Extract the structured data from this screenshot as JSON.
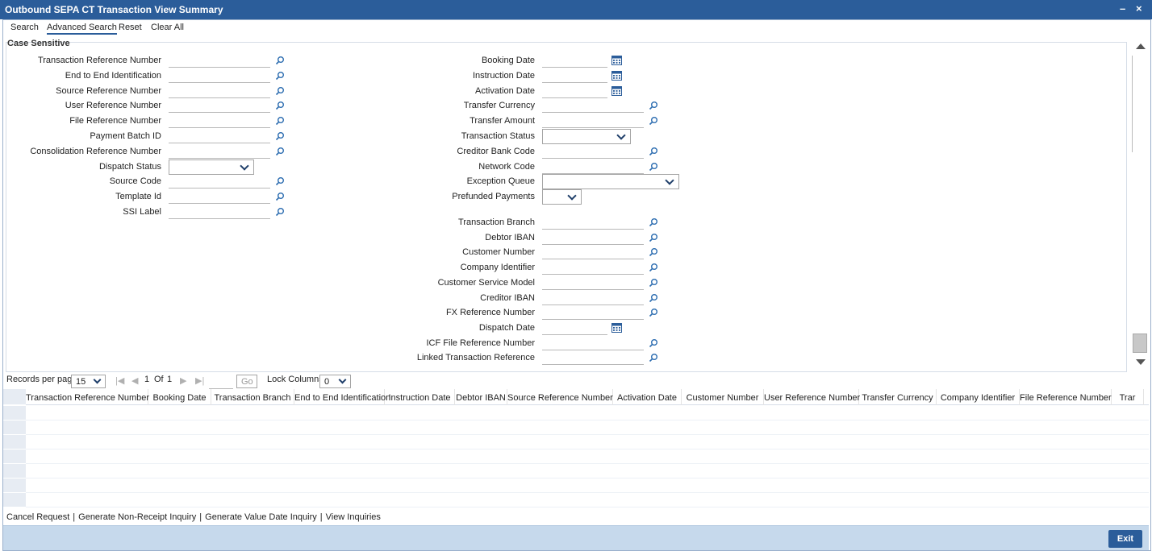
{
  "window": {
    "title": "Outbound SEPA CT Transaction View Summary",
    "minimize": "–",
    "close": "×"
  },
  "tabs": [
    "Search",
    "Advanced Search",
    "Reset",
    "Clear All"
  ],
  "active_tab": "Advanced Search",
  "case_sensitive": "Case Sensitive",
  "left_fields": [
    {
      "label": "Transaction Reference Number",
      "type": "lookup"
    },
    {
      "label": "End to End Identification",
      "type": "lookup"
    },
    {
      "label": "Source Reference Number",
      "type": "lookup"
    },
    {
      "label": "User Reference Number",
      "type": "lookup"
    },
    {
      "label": "File Reference Number",
      "type": "lookup"
    },
    {
      "label": "Payment Batch ID",
      "type": "lookup"
    },
    {
      "label": "Consolidation Reference Number",
      "type": "lookup"
    },
    {
      "label": "Dispatch Status",
      "type": "select"
    },
    {
      "label": "Source Code",
      "type": "lookup"
    },
    {
      "label": "Template Id",
      "type": "lookup"
    },
    {
      "label": "SSI Label",
      "type": "lookup"
    }
  ],
  "right_fields": [
    {
      "label": "Booking Date",
      "type": "date"
    },
    {
      "label": "Instruction Date",
      "type": "date"
    },
    {
      "label": "Activation Date",
      "type": "date"
    },
    {
      "label": "Transfer Currency",
      "type": "lookup"
    },
    {
      "label": "Transfer Amount",
      "type": "lookup"
    },
    {
      "label": "Transaction Status",
      "type": "select"
    },
    {
      "label": "Creditor Bank Code",
      "type": "lookup"
    },
    {
      "label": "Network Code",
      "type": "lookup"
    },
    {
      "label": "Exception Queue",
      "type": "select"
    },
    {
      "label": "Prefunded Payments",
      "type": "select"
    },
    {
      "label": "Transaction Branch",
      "type": "lookup"
    },
    {
      "label": "Debtor IBAN",
      "type": "lookup"
    },
    {
      "label": "Customer Number",
      "type": "lookup"
    },
    {
      "label": "Company Identifier",
      "type": "lookup"
    },
    {
      "label": "Customer Service Model",
      "type": "lookup"
    },
    {
      "label": "Creditor IBAN",
      "type": "lookup"
    },
    {
      "label": "FX Reference Number",
      "type": "lookup"
    },
    {
      "label": "Dispatch Date",
      "type": "date"
    },
    {
      "label": "ICF File Reference Number",
      "type": "lookup"
    },
    {
      "label": "Linked Transaction Reference",
      "type": "lookup"
    }
  ],
  "pagination": {
    "records_label": "Records per page",
    "records_value": "15",
    "current_page": "1",
    "of_label": "Of",
    "total_pages": "1",
    "go_label": "Go",
    "lock_label": "Lock Columns",
    "lock_value": "0"
  },
  "grid": {
    "columns": [
      "Transaction Reference Number",
      "Booking Date",
      "Transaction Branch",
      "End to End Identification",
      "Instruction Date",
      "Debtor IBAN",
      "Source Reference Number",
      "Activation Date",
      "Customer Number",
      "User Reference Number",
      "Transfer Currency",
      "Company Identifier",
      "File Reference Number",
      "Trar"
    ],
    "row_count": 7
  },
  "actions": [
    "Cancel Request",
    "Generate Non-Receipt Inquiry",
    "Generate Value Date Inquiry",
    "View Inquiries"
  ],
  "footer": {
    "exit_label": "Exit"
  },
  "colors": {
    "titlebar": "#2b5d9a",
    "footer": "#c6d9ec",
    "icon": "#2b6cb0"
  }
}
